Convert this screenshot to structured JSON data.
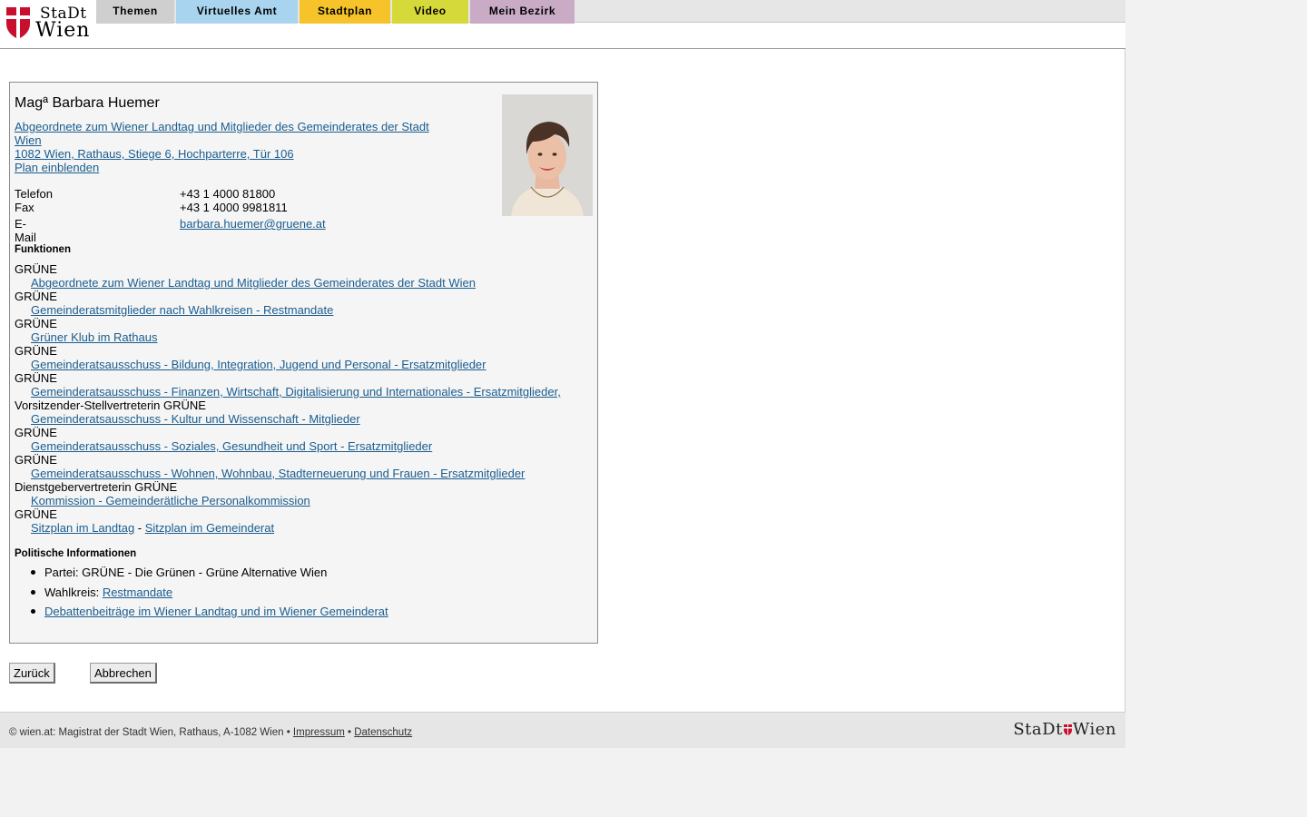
{
  "logo": {
    "line1": "StaDt",
    "line2": "Wien"
  },
  "nav": {
    "tabs": [
      "Themen",
      "Virtuelles Amt",
      "Stadtplan",
      "Video",
      "Mein Bezirk"
    ]
  },
  "person": {
    "name": "Magª Barbara Huemer",
    "role_link": "Abgeordnete zum Wiener Landtag und Mitglieder des Gemeinderates der Stadt Wien",
    "address_link": "1082 Wien, Rathaus, Stiege 6, Hochparterre, Tür 106",
    "plan_link": "Plan einblenden",
    "contact": [
      {
        "label": "Telefon",
        "value": "+43 1 4000 81800"
      },
      {
        "label": "Fax",
        "value": "+43 1 4000 9981811"
      },
      {
        "label": "E-Mail",
        "value": "barbara.huemer@gruene.at"
      }
    ]
  },
  "functions": {
    "heading": "Funktionen",
    "items": [
      {
        "role": "GRÜNE",
        "link": "Abgeordnete zum Wiener Landtag und Mitglieder des Gemeinderates der Stadt Wien"
      },
      {
        "role": "GRÜNE",
        "link": "Gemeinderatsmitglieder nach Wahlkreisen - Restmandate"
      },
      {
        "role": "GRÜNE",
        "link": "Grüner Klub im Rathaus"
      },
      {
        "role": "GRÜNE",
        "link": "Gemeinderatsausschuss - Bildung, Integration, Jugend und Personal - Ersatzmitglieder"
      },
      {
        "role": "GRÜNE",
        "link": "Gemeinderatsausschuss - Finanzen, Wirtschaft, Digitalisierung und Internationales - Ersatzmitglieder, "
      },
      {
        "role": "Vorsitzender-Stellvertreterin GRÜNE",
        "link": "Gemeinderatsausschuss - Kultur und Wissenschaft - Mitglieder"
      },
      {
        "role": "GRÜNE",
        "link": "Gemeinderatsausschuss - Soziales, Gesundheit und Sport - Ersatzmitglieder"
      },
      {
        "role": "GRÜNE",
        "link": "Gemeinderatsausschuss - Wohnen, Wohnbau, Stadterneuerung und Frauen - Ersatzmitglieder"
      },
      {
        "role": "Dienstgebervertreterin GRÜNE",
        "link": "Kommission - Gemeinderätliche Personalkommission"
      }
    ],
    "last_role": "GRÜNE",
    "seat_link_1": "Sitzplan im Landtag",
    "seat_sep": " - ",
    "seat_link_2": "Sitzplan im Gemeinderat"
  },
  "politics": {
    "heading": "Politische Informationen",
    "party": "Partei: GRÜNE - Die Grünen - Grüne Alternative Wien",
    "district_label": "Wahlkreis: ",
    "district_link": "Restmandate",
    "debates_link": "Debattenbeiträge im Wiener Landtag und im Wiener Gemeinderat"
  },
  "buttons": {
    "back": "Zurück",
    "cancel": "Abbrechen"
  },
  "footer": {
    "text": "© wien.at: Magistrat der Stadt Wien, Rathaus, A-1082 Wien • ",
    "impressum": "Impressum",
    "sep": " • ",
    "datenschutz": "Datenschutz",
    "logo_left": "StaDt",
    "logo_right": "Wien"
  },
  "colors": {
    "link": "#1a5d8f",
    "brand_red": "#c8102e"
  }
}
